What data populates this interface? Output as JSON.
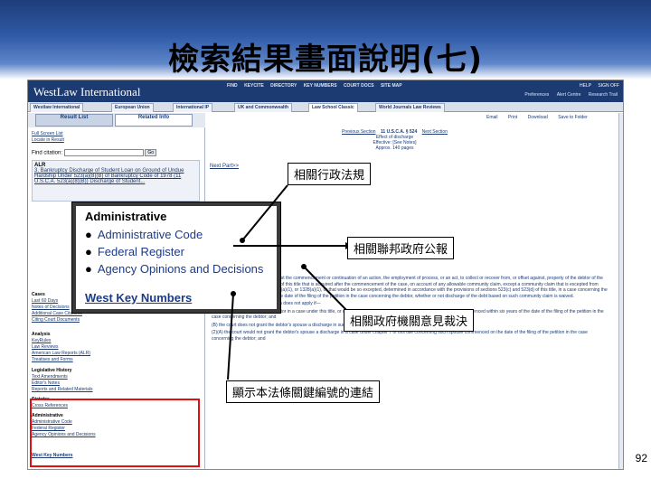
{
  "slide_title": "檢索結果畫面說明(七)",
  "page_number": "92",
  "westlaw": {
    "logo": "WestLaw International",
    "top_nav": [
      "FIND",
      "KEYCITE",
      "DIRECTORY",
      "KEY NUMBERS",
      "COURT DOCS",
      "SITE MAP"
    ],
    "right_nav": [
      "HELP",
      "SIGN OFF"
    ],
    "sub_nav": [
      "Preferences",
      "Alert Centre",
      "Research Trail"
    ],
    "tabs": [
      "Westlaw International",
      "European Union",
      "International IP",
      "UK and Commonwealth",
      "Law School Classic",
      "World Journals Law Reviews"
    ],
    "result_tabs": [
      "Result List",
      "Related Info"
    ],
    "left_links": [
      "Full Screen List",
      "Locate in Result"
    ],
    "find_label": "Find citation:",
    "find_go": "Go",
    "alr_heading": "ALR",
    "alr_text": "3. Bankruptcy Discharge of Student Loan on Ground of Undue Hardship Under 523(a)(8)(B) of Bankruptcy Code of 1978 (11 U.S.C.A. 523(a)(8)(B)) Discharge of Student...",
    "cases_heading": "Cases",
    "cases_items": [
      "Last 60 Days",
      "Notes of Decisions",
      "Additional Case Citations",
      "Citing Court Documents"
    ],
    "analysis_heading": "Analysis",
    "analysis_items": [
      "KeyRules",
      "Law Reviews",
      "American Law Reports (ALR)",
      "Treatises and Forms"
    ],
    "legislative_heading": "Legislative History",
    "legislative_items": [
      "Text Amendments",
      "Editor's Notes",
      "Reports and Related Materials"
    ],
    "statutes_heading": "Statutes",
    "statutes_items": [
      "Cross References"
    ],
    "admin_heading": "Administrative",
    "admin_items": [
      "Administrative Code",
      "Federal Register",
      "Agency Opinions and Decisions"
    ],
    "wkn_link": "West Key Numbers",
    "doc_tools": [
      "Email",
      "Print",
      "Download",
      "Save to Folder"
    ],
    "doc_citation": "11 U.S.C.A. § 524",
    "doc_nav_prev": "Previous Section",
    "doc_nav_next": "Next Section",
    "doc_head_lines": [
      "Effect of discharge",
      "Effective: [See Notes]",
      "Approx. 140 pages"
    ],
    "next_part": "Next Part>>",
    "doc_paragraphs": [
      "(2) operates as an injunction against the commencement or continuation of an action, the employment of process, or an act, to collect or recover from, or offset against, property of the debtor of the kind specified in section 541(a)(2) of this title that is acquired after the commencement of the case, on account of any allowable community claim, except a community claim that is excepted from discharge under section 523, 1228(a)(1), or 1328(a)(1), or that would be so excepted, determined in accordance with the provisions of sections 523(c) and 523(d) of this title, in a case concerning the debtor's spouse commenced on the date of the filing of the petition in the case concerning the debtor, whether or not discharge of the debt based on such community claim is waived.",
      "(b) Subsection (a)(3) of this section does not apply if—",
      "(1)(A) the debtor's spouse is a debtor in a case under this title, or a bankrupt or a debtor in a case under the Bankruptcy Act, commenced within six years of the date of the filing of the petition in the case concerning the debtor; and",
      "(B) the court does not grant the debtor's spouse a discharge in such case concerning the debtor's spouse; or",
      "(2)(A) the court would not grant the debtor's spouse a discharge in a case under chapter 7 of this title concerning such spouse commenced on the date of the filing of the petition in the case concerning the debtor; and"
    ]
  },
  "zoom": {
    "title": "Administrative",
    "items": [
      "Administrative Code",
      "Federal Register",
      "Agency Opinions and Decisions"
    ],
    "wkn": "West Key Numbers"
  },
  "callouts": {
    "admin_rules": "相關行政法規",
    "federal_register": "相關聯邦政府公報",
    "agency_opinions": "相關政府機關意見裁決",
    "key_numbers": "顯示本法條關鍵編號的連結"
  },
  "colors": {
    "banner": "#1e3d7a",
    "link": "#1a3a8a",
    "highlight_box": "#e01010"
  }
}
